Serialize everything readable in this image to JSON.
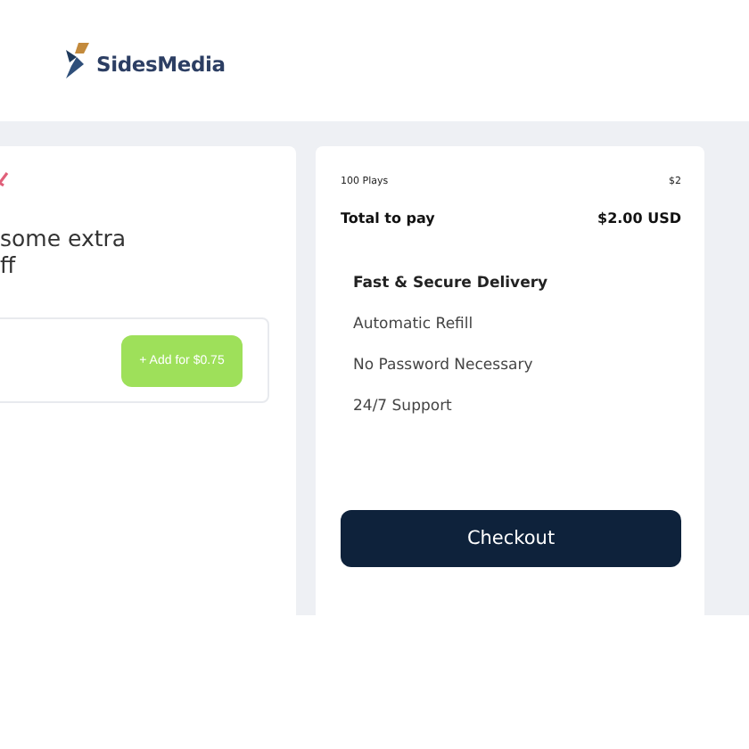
{
  "header": {
    "logo_text": "SidesMedia"
  },
  "upsell": {
    "lines": [
      "some extra",
      "ff"
    ],
    "button": "+ Add for $0.75"
  },
  "summary": {
    "item": "100 Plays",
    "item_price": "$2",
    "total_label": "Total to pay",
    "total_amount": "$2.00 USD",
    "features": [
      {
        "kind": "heading",
        "text": "Fast & Secure Delivery"
      },
      {
        "kind": "plain",
        "text": "Automatic Refill"
      },
      {
        "kind": "plain",
        "text": "No Password Necessary"
      },
      {
        "kind": "plain",
        "text": "24/7 Support"
      }
    ],
    "button": "Checkout"
  }
}
